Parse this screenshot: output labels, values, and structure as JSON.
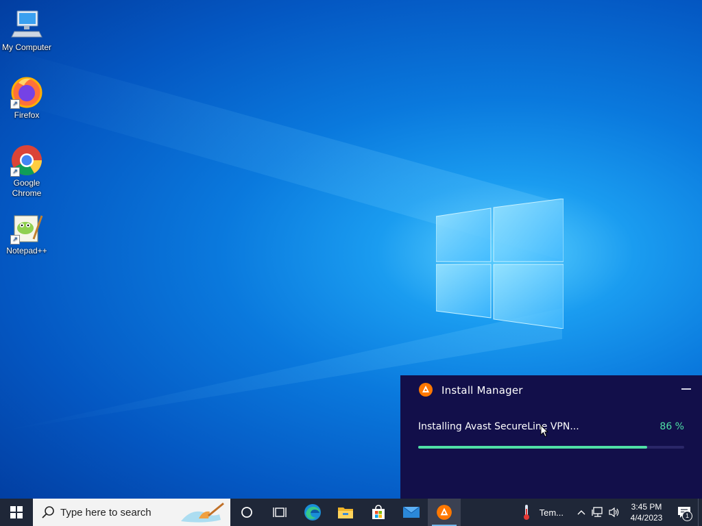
{
  "desktop_icons": [
    {
      "label": "My Computer",
      "icon": "computer-icon"
    },
    {
      "label": "Firefox",
      "icon": "firefox-icon"
    },
    {
      "label": "Google Chrome",
      "icon": "chrome-icon"
    },
    {
      "label": "Notepad++",
      "icon": "notepadpp-icon"
    }
  ],
  "installer": {
    "title": "Install Manager",
    "status": "Installing Avast SecureLine VPN...",
    "percent_text": "86 %",
    "progress": 0.86,
    "accent": "#4fe0a6",
    "background": "#120f4a"
  },
  "taskbar": {
    "search_placeholder": "Type here to search",
    "apps": [
      {
        "name": "Cortana",
        "icon": "cortana-icon"
      },
      {
        "name": "Task View",
        "icon": "task-view-icon"
      },
      {
        "name": "Microsoft Edge",
        "icon": "edge-icon"
      },
      {
        "name": "File Explorer",
        "icon": "folder-icon"
      },
      {
        "name": "Microsoft Store",
        "icon": "store-icon"
      },
      {
        "name": "Mail",
        "icon": "mail-icon"
      },
      {
        "name": "Avast",
        "icon": "avast-icon",
        "active": true
      }
    ],
    "weather_text": "Tem...",
    "time": "3:45 PM",
    "date": "4/4/2023",
    "notification_count": "1"
  }
}
